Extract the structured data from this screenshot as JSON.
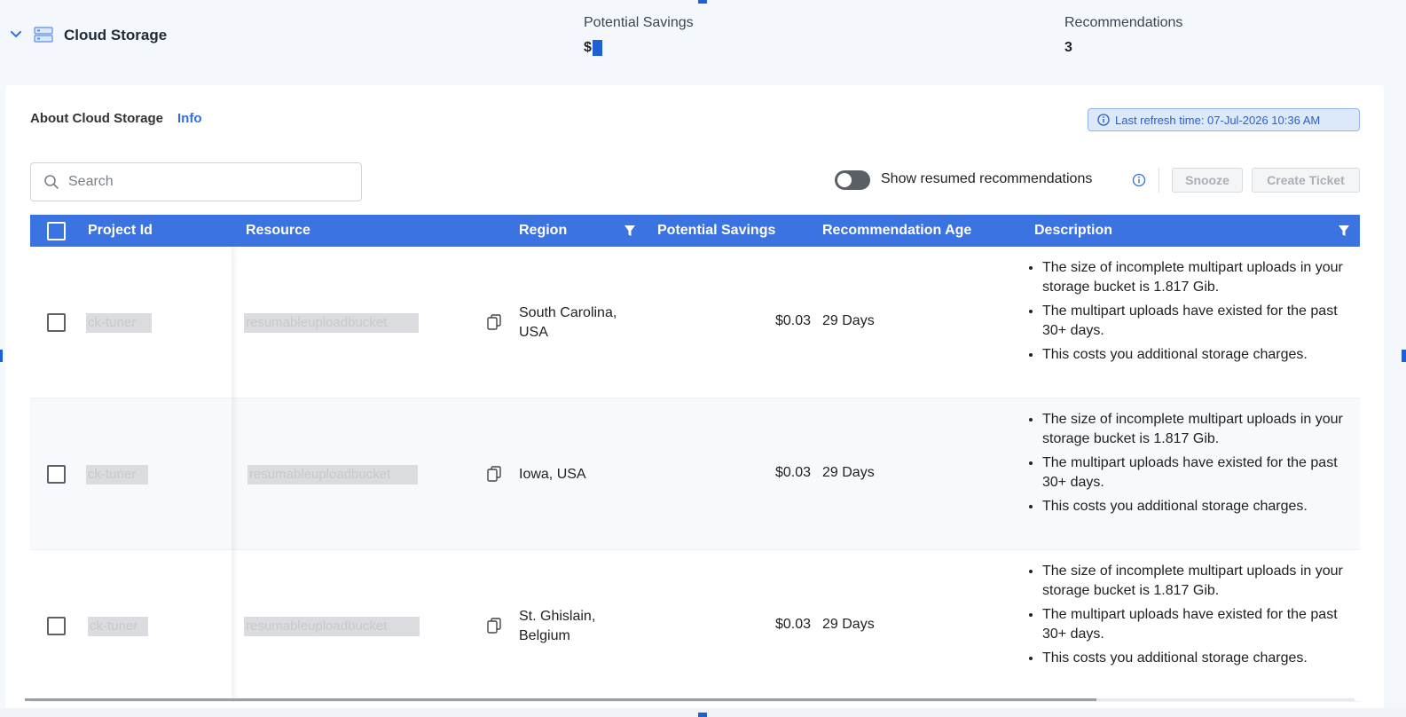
{
  "header": {
    "title": "Cloud Storage",
    "kpis": {
      "savings_label": "Potential Savings",
      "savings_value": "$",
      "recommendations_label": "Recommendations",
      "recommendations_value": "3"
    }
  },
  "about": {
    "label": "About Cloud Storage",
    "info_link": "Info"
  },
  "refresh": {
    "text": "Last refresh time: 07-Jul-2026 10:36 AM"
  },
  "search": {
    "placeholder": "Search",
    "value": ""
  },
  "toolbar": {
    "toggle_label": "Show resumed recommendations",
    "toggle_on": false,
    "snooze_label": "Snooze",
    "create_ticket_label": "Create Ticket"
  },
  "table": {
    "columns": [
      "Project Id",
      "Resource",
      "Region",
      "Potential Savings",
      "Recommendation Age",
      "Description"
    ],
    "rows": [
      {
        "project_id": "ck-tuner",
        "resource": "resumableuploadbucket",
        "region_line1": "South Carolina,",
        "region_line2": "USA",
        "savings": "$0.03",
        "age": "29 Days",
        "description": [
          "The size of incomplete multipart uploads in your storage bucket is 1.817 Gib.",
          "The multipart uploads have existed for the past 30+ days.",
          "This costs you additional storage charges."
        ]
      },
      {
        "project_id": "ck-tuner",
        "resource": "resumableuploadbucket",
        "region_line1": "Iowa, USA",
        "region_line2": "",
        "savings": "$0.03",
        "age": "29 Days",
        "description": [
          "The size of incomplete multipart uploads in your storage bucket is 1.817 Gib.",
          "The multipart uploads have existed for the past 30+ days.",
          "This costs you additional storage charges."
        ]
      },
      {
        "project_id": "ck-tuner",
        "resource": "resumableuploadbucket",
        "region_line1": "St. Ghislain,",
        "region_line2": "Belgium",
        "savings": "$0.03",
        "age": "29 Days",
        "description": [
          "The size of incomplete multipart uploads in your storage bucket is 1.817 Gib.",
          "The multipart uploads have existed for the past 30+ days.",
          "This costs you additional storage charges."
        ]
      }
    ]
  },
  "colors": {
    "accent": "#3b73e0",
    "link": "#2f6fde",
    "page_bg": "#f4f8fd"
  }
}
